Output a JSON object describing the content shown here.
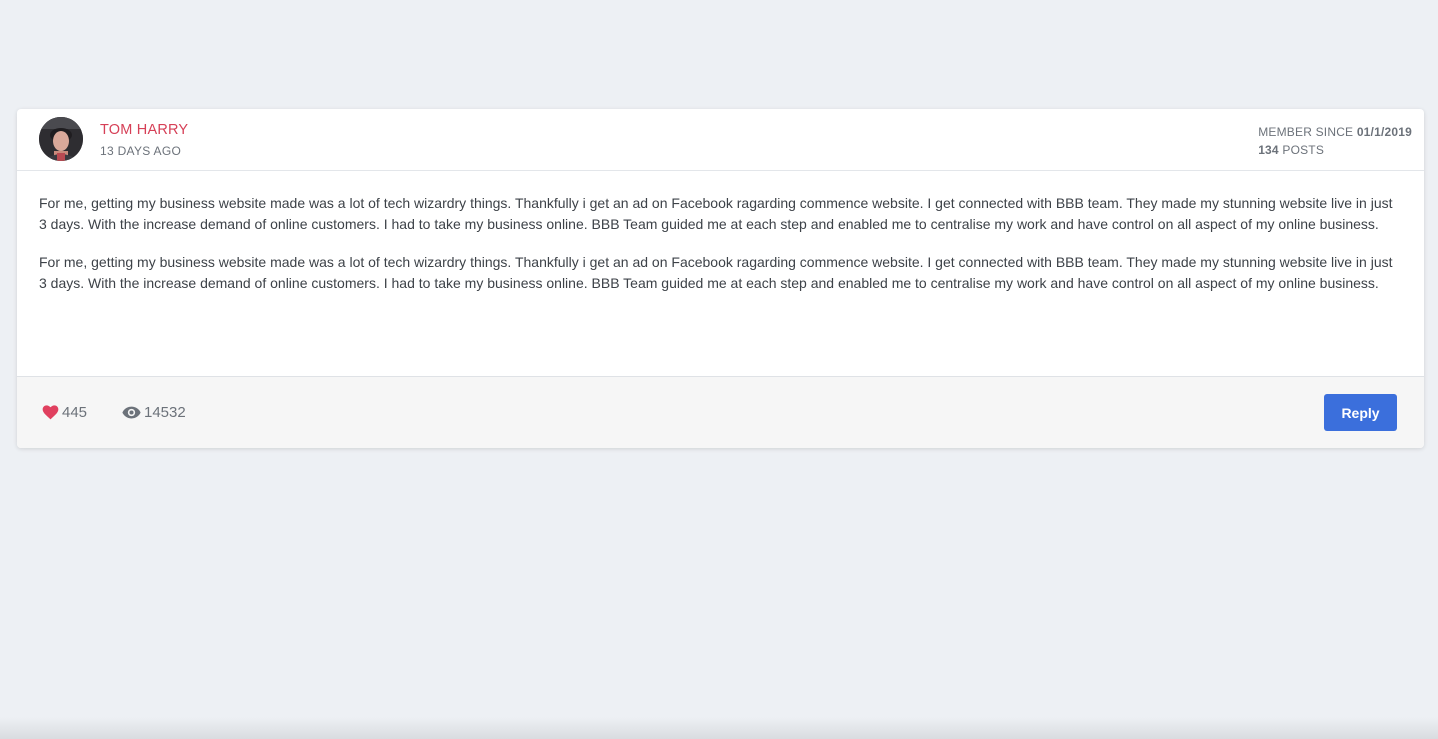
{
  "post": {
    "author": {
      "name": "TOM HARRY",
      "time_ago": "13 DAYS AGO"
    },
    "member": {
      "since_label": "MEMBER SINCE",
      "since_date": "01/1/2019",
      "posts_count": "134",
      "posts_label": "POSTS"
    },
    "paragraphs": [
      "For me, getting my business website made was a lot of tech wizardry things. Thankfully i get an ad on Facebook ragarding commence website. I get connected with BBB team. They made my stunning website live in just 3 days. With the increase demand of online customers. I had to take my business online. BBB Team guided me at each step and enabled me to centralise my work and have control on all aspect of my online business.",
      "For me, getting my business website made was a lot of tech wizardry things. Thankfully i get an ad on Facebook ragarding commence website. I get connected with BBB team. They made my stunning website live in just 3 days. With the increase demand of online customers. I had to take my business online. BBB Team guided me at each step and enabled me to centralise my work and have control on all aspect of my online business."
    ],
    "stats": {
      "likes": "445",
      "views": "14532"
    },
    "reply_label": "Reply"
  },
  "icons": {
    "like": "heart-icon",
    "views": "eye-icon"
  },
  "colors": {
    "author_name": "#d64057",
    "heart": "#e0405f",
    "reply_button": "#3b6fdc",
    "page_background": "#edf0f4"
  }
}
